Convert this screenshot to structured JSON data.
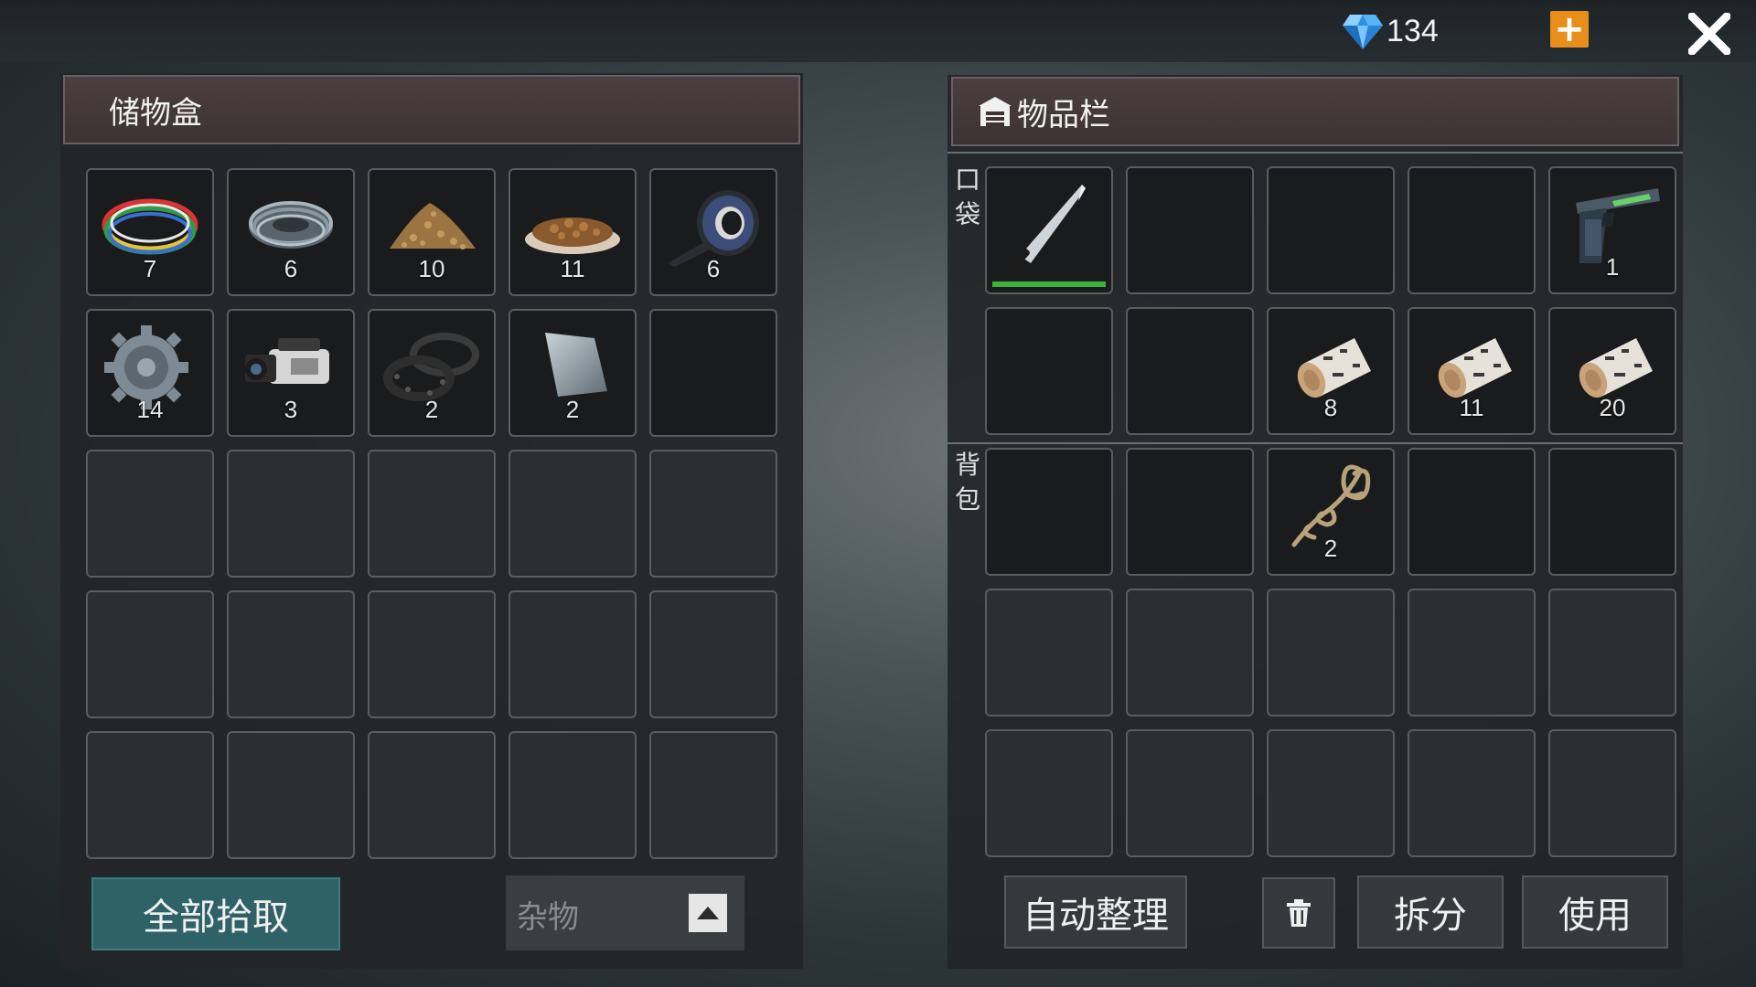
{
  "topbar": {
    "gem_count": "134",
    "gem_icon": "diamond-icon",
    "plus_label": "+",
    "close_label": "X"
  },
  "storage": {
    "title": "储物盒",
    "slots": [
      {
        "item": "colored-wire-bundle-icon",
        "count": "7"
      },
      {
        "item": "steel-wire-coil-icon",
        "count": "6"
      },
      {
        "item": "grain-pile-icon",
        "count": "10"
      },
      {
        "item": "pet-food-plate-icon",
        "count": "11"
      },
      {
        "item": "duct-tape-icon",
        "count": "6"
      },
      {
        "item": "gear-icon",
        "count": "14"
      },
      {
        "item": "video-camera-icon",
        "count": "3"
      },
      {
        "item": "rubber-gaskets-icon",
        "count": "2"
      },
      {
        "item": "metal-plate-icon",
        "count": "2"
      }
    ],
    "pickup_all_label": "全部拾取",
    "filter_label": "杂物"
  },
  "inventory": {
    "title": "物品栏",
    "pocket_label": "口袋",
    "backpack_label": "背包",
    "pocket_slots": [
      {
        "item": "machete-icon",
        "count": "",
        "durability": 1.0
      },
      {
        "item": "",
        "count": ""
      },
      {
        "item": "",
        "count": ""
      },
      {
        "item": "",
        "count": ""
      },
      {
        "item": "pistol-icon",
        "count": "1"
      },
      {
        "item": "",
        "count": ""
      },
      {
        "item": "",
        "count": ""
      },
      {
        "item": "birch-log-icon",
        "count": "8"
      },
      {
        "item": "birch-log-icon",
        "count": "11"
      },
      {
        "item": "birch-log-icon",
        "count": "20"
      }
    ],
    "backpack_slots": [
      {
        "item": "",
        "count": ""
      },
      {
        "item": "",
        "count": ""
      },
      {
        "item": "rope-icon",
        "count": "2"
      },
      {
        "item": "",
        "count": ""
      },
      {
        "item": "",
        "count": ""
      }
    ],
    "autosort_label": "自动整理",
    "split_label": "拆分",
    "use_label": "使用"
  },
  "colors": {
    "accent_orange": "#e88e1a",
    "pickup_teal": "#2e6266",
    "durability_green": "#3bb03b",
    "header_maroon": "#4a3e40"
  }
}
